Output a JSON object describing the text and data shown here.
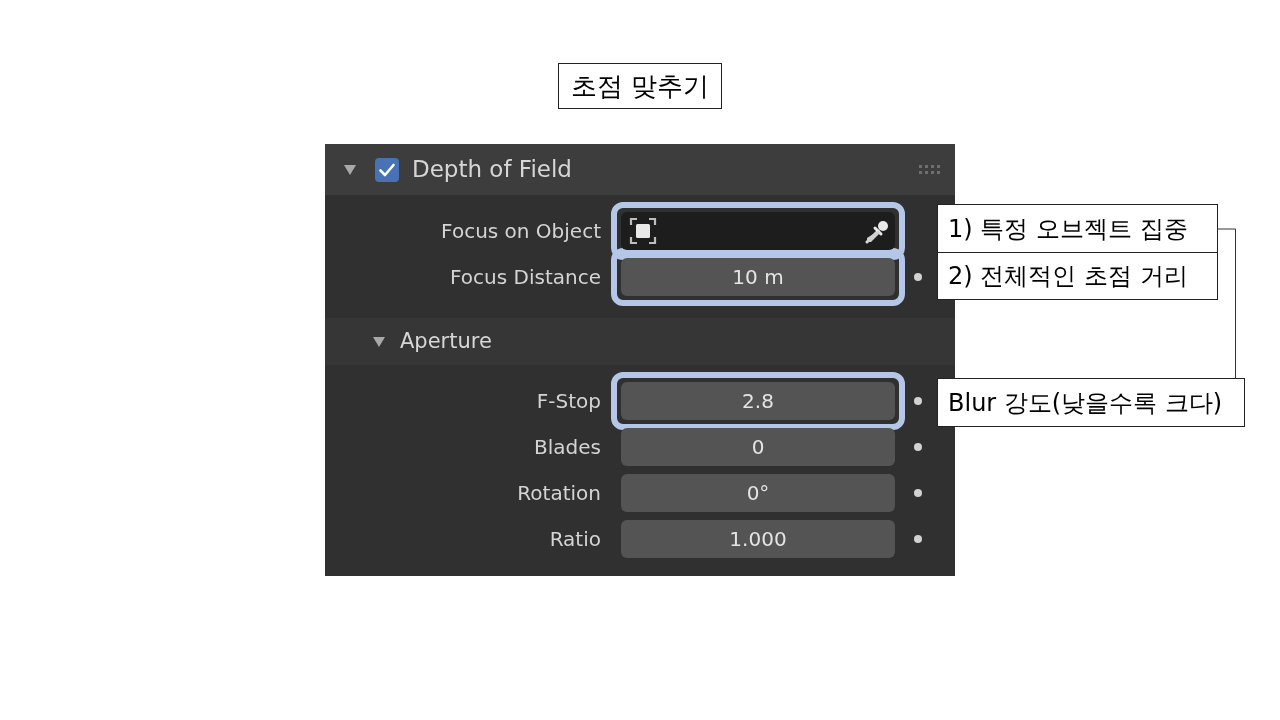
{
  "title": "초점 맞추기",
  "panel": {
    "title": "Depth of Field",
    "expanded": true,
    "checked": true,
    "rows": [
      {
        "kind": "object",
        "label": "Focus on Object",
        "highlighted": true
      },
      {
        "kind": "number",
        "label": "Focus Distance",
        "value": "10 m",
        "highlighted": true
      }
    ],
    "subpanel": {
      "title": "Aperture",
      "expanded": true,
      "rows": [
        {
          "kind": "number",
          "label": "F-Stop",
          "value": "2.8",
          "highlighted": true
        },
        {
          "kind": "number",
          "label": "Blades",
          "value": "0",
          "highlighted": false
        },
        {
          "kind": "number",
          "label": "Rotation",
          "value": "0°",
          "highlighted": false
        },
        {
          "kind": "number",
          "label": "Ratio",
          "value": "1.000",
          "highlighted": false
        }
      ]
    }
  },
  "callouts": [
    "1) 특정 오브젝트 집중",
    "2) 전체적인 초점 거리",
    "Blur 강도(낮을수록 크다)"
  ]
}
